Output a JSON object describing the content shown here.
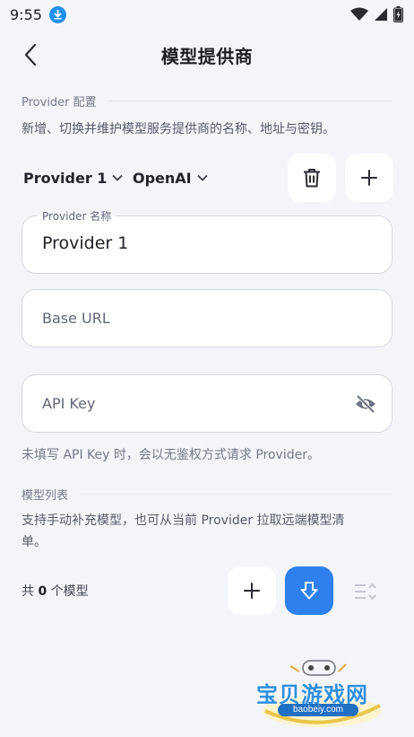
{
  "status_bar": {
    "time": "9:55"
  },
  "app_bar": {
    "title": "模型提供商"
  },
  "provider_section": {
    "header": "Provider 配置",
    "description": "新增、切换并维护模型服务提供商的名称、地址与密钥。",
    "selected_provider": "Provider 1",
    "selected_type": "OpenAI",
    "name_field": {
      "label": "Provider 名称",
      "value": "Provider 1"
    },
    "base_url_field": {
      "placeholder": "Base URL"
    },
    "api_key_field": {
      "placeholder": "API Key"
    },
    "hint": "未填写 API Key 时，会以无鉴权方式请求 Provider。"
  },
  "models_section": {
    "header": "模型列表",
    "description_line1": "支持手动补充模型，也可从当前 Provider 拉取远端模型清",
    "description_line2": "单。",
    "count_prefix": "共",
    "count_value": "0",
    "count_suffix": "个模型"
  },
  "watermark": {
    "title": "宝贝游戏网",
    "url": "baobeiy.com"
  },
  "colors": {
    "accent": "#2d80ee",
    "background": "#f4f5f9"
  }
}
